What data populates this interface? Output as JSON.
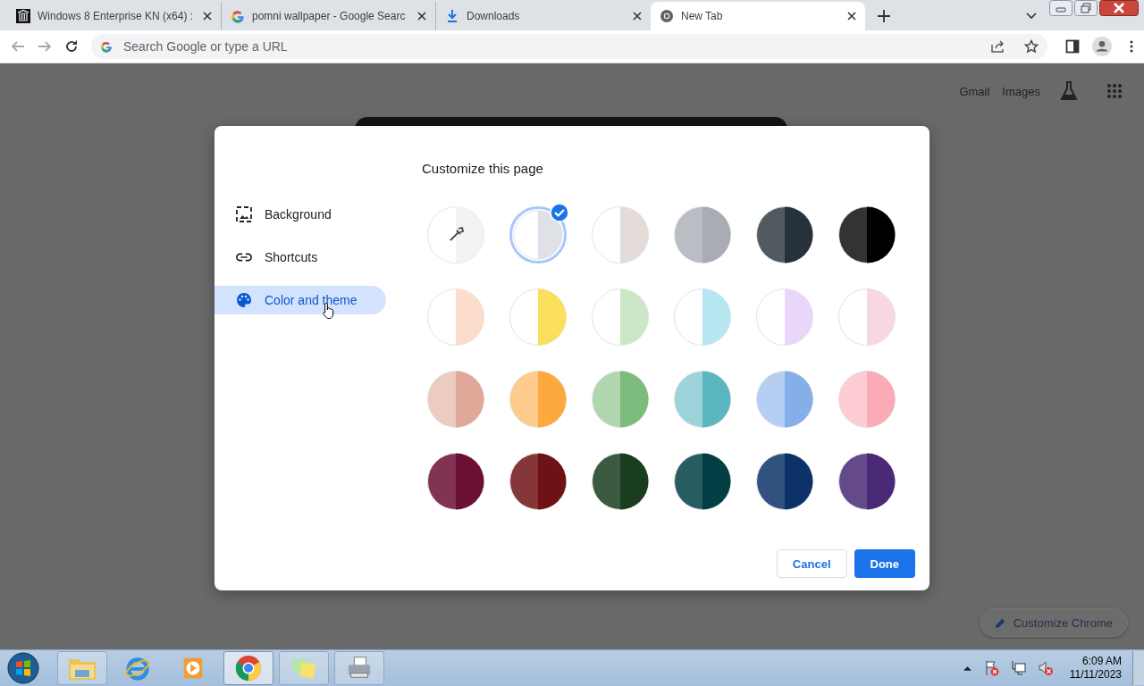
{
  "browser": {
    "tabs": [
      {
        "title": "Windows 8 Enterprise KN (x64) :",
        "selected": false
      },
      {
        "title": "pomni wallpaper - Google Searc",
        "selected": false
      },
      {
        "title": "Downloads",
        "selected": false
      },
      {
        "title": "New Tab",
        "selected": true
      }
    ],
    "address_bar": {
      "placeholder": "Search Google or type a URL"
    }
  },
  "page": {
    "top_links": [
      "Gmail",
      "Images"
    ],
    "customize_button": "Customize Chrome"
  },
  "dialog": {
    "title": "Customize this page",
    "menu": [
      {
        "label": "Background",
        "selected": false
      },
      {
        "label": "Shortcuts",
        "selected": false
      },
      {
        "label": "Color and theme",
        "selected": true
      }
    ],
    "themes": [
      {
        "kind": "custom",
        "color": "#f1f3f4",
        "selected": false
      },
      {
        "kind": "preset",
        "color": "#dee1e6",
        "selected": true
      },
      {
        "kind": "preset",
        "color": "#e3dcd9",
        "selected": false
      },
      {
        "kind": "preset",
        "color": "#a9acb4",
        "selected": false
      },
      {
        "kind": "preset",
        "color": "#27313a",
        "selected": false
      },
      {
        "kind": "preset",
        "color": "#000000",
        "selected": false
      },
      {
        "kind": "preset",
        "color": "#fcdccb",
        "selected": false
      },
      {
        "kind": "preset",
        "color": "#fddf5e",
        "selected": false
      },
      {
        "kind": "preset",
        "color": "#cbe7c6",
        "selected": false
      },
      {
        "kind": "preset",
        "color": "#b6e6f0",
        "selected": false
      },
      {
        "kind": "preset",
        "color": "#e8d6fb",
        "selected": false
      },
      {
        "kind": "preset",
        "color": "#f7d7e4",
        "selected": false
      },
      {
        "kind": "preset",
        "color": "#e0a898",
        "selected": false
      },
      {
        "kind": "preset",
        "color": "#fca93d",
        "selected": false
      },
      {
        "kind": "preset",
        "color": "#7bbb7b",
        "selected": false
      },
      {
        "kind": "preset",
        "color": "#5ab7bf",
        "selected": false
      },
      {
        "kind": "preset",
        "color": "#86aee8",
        "selected": false
      },
      {
        "kind": "preset",
        "color": "#fbaab7",
        "selected": false
      },
      {
        "kind": "preset",
        "color": "#6c0f35",
        "selected": false
      },
      {
        "kind": "preset",
        "color": "#6e1216",
        "selected": false
      },
      {
        "kind": "preset",
        "color": "#1a3d1f",
        "selected": false
      },
      {
        "kind": "preset",
        "color": "#013f44",
        "selected": false
      },
      {
        "kind": "preset",
        "color": "#0d3267",
        "selected": false
      },
      {
        "kind": "preset",
        "color": "#4a2a76",
        "selected": false
      }
    ],
    "buttons": {
      "cancel": "Cancel",
      "done": "Done"
    }
  },
  "taskbar": {
    "apps": [
      {
        "active": false
      },
      {
        "active": false
      },
      {
        "active": false
      },
      {
        "active": true
      },
      {
        "active": false
      },
      {
        "active": false
      }
    ],
    "clock": {
      "time": "6:09 AM",
      "date": "11/11/2023"
    }
  }
}
